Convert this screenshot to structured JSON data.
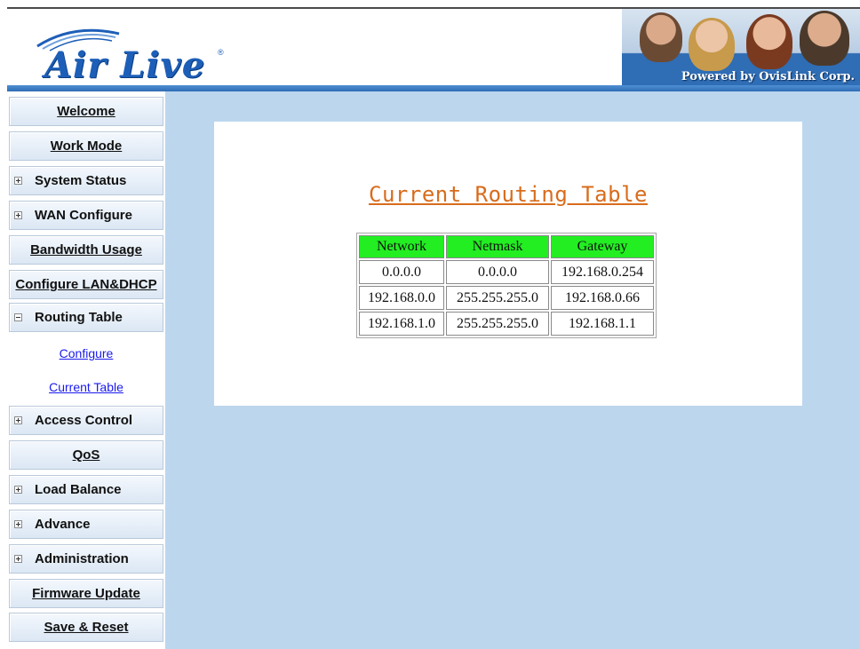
{
  "header": {
    "logo_text": "Air Live",
    "logo_registered": "®",
    "powered_by": "Powered by OvisLink Corp."
  },
  "sidebar": {
    "items": [
      {
        "label": "Welcome",
        "kind": "button"
      },
      {
        "label": "Work Mode",
        "kind": "button"
      },
      {
        "label": "System Status",
        "kind": "tree",
        "expanded": false
      },
      {
        "label": "WAN Configure",
        "kind": "tree",
        "expanded": false
      },
      {
        "label": "Bandwidth Usage",
        "kind": "button"
      },
      {
        "label": "Configure LAN&DHCP",
        "kind": "button"
      },
      {
        "label": "Routing Table",
        "kind": "tree",
        "expanded": true
      },
      {
        "label": "Configure",
        "kind": "link"
      },
      {
        "label": "Current Table",
        "kind": "link"
      },
      {
        "label": "Access Control",
        "kind": "tree",
        "expanded": false
      },
      {
        "label": "QoS",
        "kind": "button"
      },
      {
        "label": "Load Balance",
        "kind": "tree",
        "expanded": false
      },
      {
        "label": "Advance",
        "kind": "tree",
        "expanded": false
      },
      {
        "label": "Administration",
        "kind": "tree",
        "expanded": false
      },
      {
        "label": "Firmware Update",
        "kind": "button"
      },
      {
        "label": "Save & Reset",
        "kind": "button"
      }
    ]
  },
  "main": {
    "title": "Current Routing Table",
    "table": {
      "headers": [
        "Network",
        "Netmask",
        "Gateway"
      ],
      "rows": [
        [
          "0.0.0.0",
          "0.0.0.0",
          "192.168.0.254"
        ],
        [
          "192.168.0.0",
          "255.255.255.0",
          "192.168.0.66"
        ],
        [
          "192.168.1.0",
          "255.255.255.0",
          "192.168.1.1"
        ]
      ]
    }
  },
  "colors": {
    "main_bg": "#bcd6ee",
    "title": "#d86c1c",
    "table_header": "#22ee22",
    "link": "#1a1aee",
    "logo": "#1d5fb8"
  }
}
